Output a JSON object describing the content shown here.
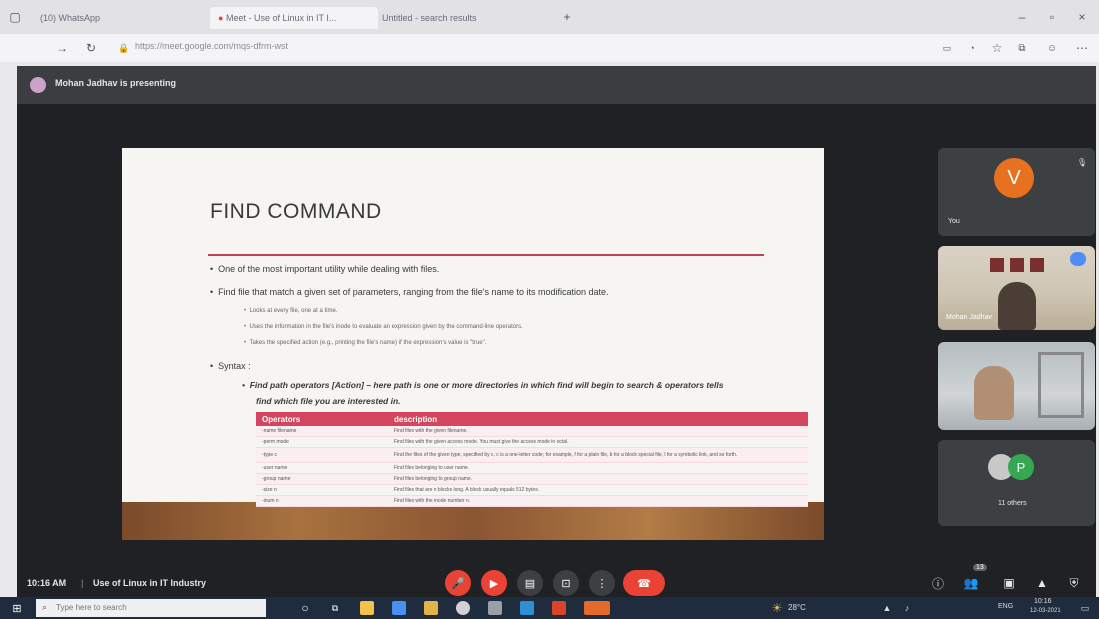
{
  "browser": {
    "tabs": [
      {
        "label": "(10) WhatsApp"
      },
      {
        "label": "Meet - Use of Linux in IT I..."
      },
      {
        "label": "Untitled - search results"
      }
    ],
    "url": "https://meet.google.com/mqs-dfrm-wst"
  },
  "meet": {
    "presenter_text": "Mohan Jadhav is presenting",
    "time": "10:16 AM",
    "meeting_name": "Use of Linux in IT Industry",
    "participants_badge": "13"
  },
  "slide": {
    "title": "FIND COMMAND",
    "bullets": [
      "One of the most important utility while dealing with files.",
      "Find file that match a given set of parameters, ranging from the file's name to its modification date."
    ],
    "sub_bullets": [
      "Looks at every file, one at a time.",
      "Uses the information in the file's inode to evaluate an expression given by the command-line operators.",
      "Takes the specified action (e.g., printing the file's name) if the expression's value is \"true\"."
    ],
    "syntax_label": "Syntax :",
    "syntax_text_line1": "Find path operators [Action] – here path is one or more directories in which find will begin to search & operators tells",
    "syntax_text_line2": "find which file you are interested in.",
    "table": {
      "headers": [
        "Operators",
        "description"
      ],
      "rows": [
        [
          "-name filename",
          "Find files with the given filename."
        ],
        [
          "-perm mode",
          "Find files with the given access mode. You must give the access mode in octal."
        ],
        [
          "-type c",
          "Find the files of the given type, specified by c. c is a one-letter code; for example, f for a plain file, b for a block special file, l for a symbolic link, and so forth."
        ],
        [
          "-user name",
          "Find files belonging to user name."
        ],
        [
          "-group name",
          "Find files belonging to group name."
        ],
        [
          "-size n",
          "Find files that are n blocks long. A block usually equals 512 bytes."
        ],
        [
          "-inum n",
          "Find files with the inode number n."
        ]
      ]
    }
  },
  "tiles": {
    "you": {
      "initial": "V",
      "label": "You",
      "color": "#e8711f"
    },
    "participant2": {
      "label": "Mohan Jadhav"
    },
    "others": {
      "initial": "P",
      "label": "11 others",
      "color": "#36a852"
    }
  },
  "taskbar": {
    "search_placeholder": "Type here to search",
    "temperature": "28°C",
    "language": "ENG",
    "clock_time": "10:16",
    "clock_date": "12-03-2021"
  },
  "colors": {
    "end_call": "#ea4335",
    "mic_off": "#ea4335",
    "slide_accent": "#d4465f"
  }
}
